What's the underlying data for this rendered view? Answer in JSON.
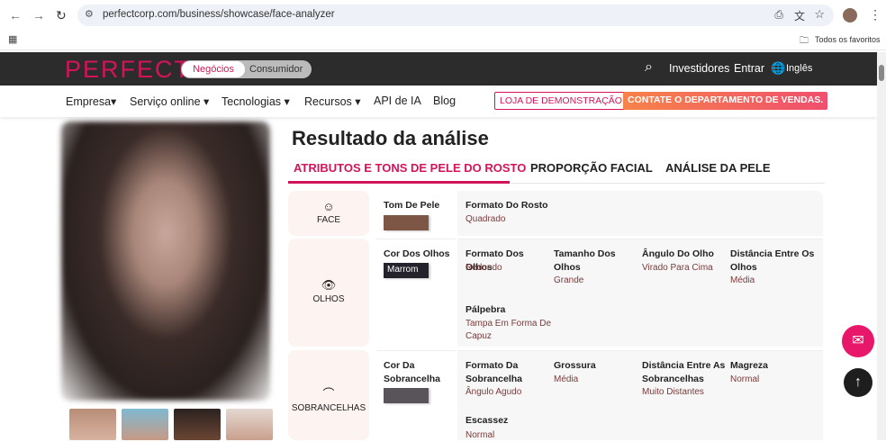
{
  "browser": {
    "url": "perfectcorp.com/business/showcase/face-analyzer",
    "bookmarks_label": "Todos os favoritos"
  },
  "header": {
    "logo": "PERFECT",
    "seg_business": "Negócios",
    "seg_consumer": "Consumidor",
    "investors": "Investidores",
    "login": "Entrar",
    "language": "Inglês"
  },
  "nav": {
    "items": [
      "Empresa▾",
      "Serviço online ▾",
      "Tecnologias ▾",
      "Recursos ▾",
      "API de IA",
      "Blog"
    ],
    "demo_store": "LOJA DE DEMONSTRAÇÃO",
    "contact_sales": "CONTATE O DEPARTAMENTO DE VENDAS."
  },
  "main": {
    "title": "Resultado da análise",
    "tabs": [
      "ATRIBUTOS E TONS DE PELE DO ROSTO",
      "PROPORÇÃO FACIAL",
      "ANÁLISE DA PELE"
    ],
    "face": {
      "category": "FACE",
      "color_label": "Tom De Pele",
      "color": "#7d5646",
      "attrs": [
        {
          "label": "Formato Do Rosto",
          "value": "Quadrado"
        }
      ]
    },
    "eyes": {
      "category": "OLHOS",
      "color_label": "Cor Dos Olhos",
      "color_value": "Marrom",
      "color": "#24222a",
      "attrs": [
        {
          "label": "Formato Dos Olhos",
          "value": "Redondo"
        },
        {
          "label": "Tamanho Dos Olhos",
          "value": "Grande"
        },
        {
          "label": "Ângulo Do Olho",
          "value": "Virado Para Cima"
        },
        {
          "label": "Distância Entre Os Olhos",
          "value": "Média"
        },
        {
          "label": "Pálpebra",
          "value": "Tampa Em Forma De Capuz"
        }
      ]
    },
    "brows": {
      "category": "SOBRANCELHAS",
      "color_label": "Cor Da Sobrancelha",
      "color": "#58545a",
      "attrs": [
        {
          "label": "Formato Da Sobrancelha",
          "value": "Ângulo Agudo"
        },
        {
          "label": "Grossura",
          "value": "Média"
        },
        {
          "label": "Distância Entre As Sobrancelhas",
          "value": "Muito Distantes"
        },
        {
          "label": "Magreza",
          "value": "Normal"
        },
        {
          "label": "Escassez",
          "value": "Normal"
        }
      ]
    }
  },
  "colors": {
    "brand": "#d4145a",
    "sales": "#f46b45"
  }
}
